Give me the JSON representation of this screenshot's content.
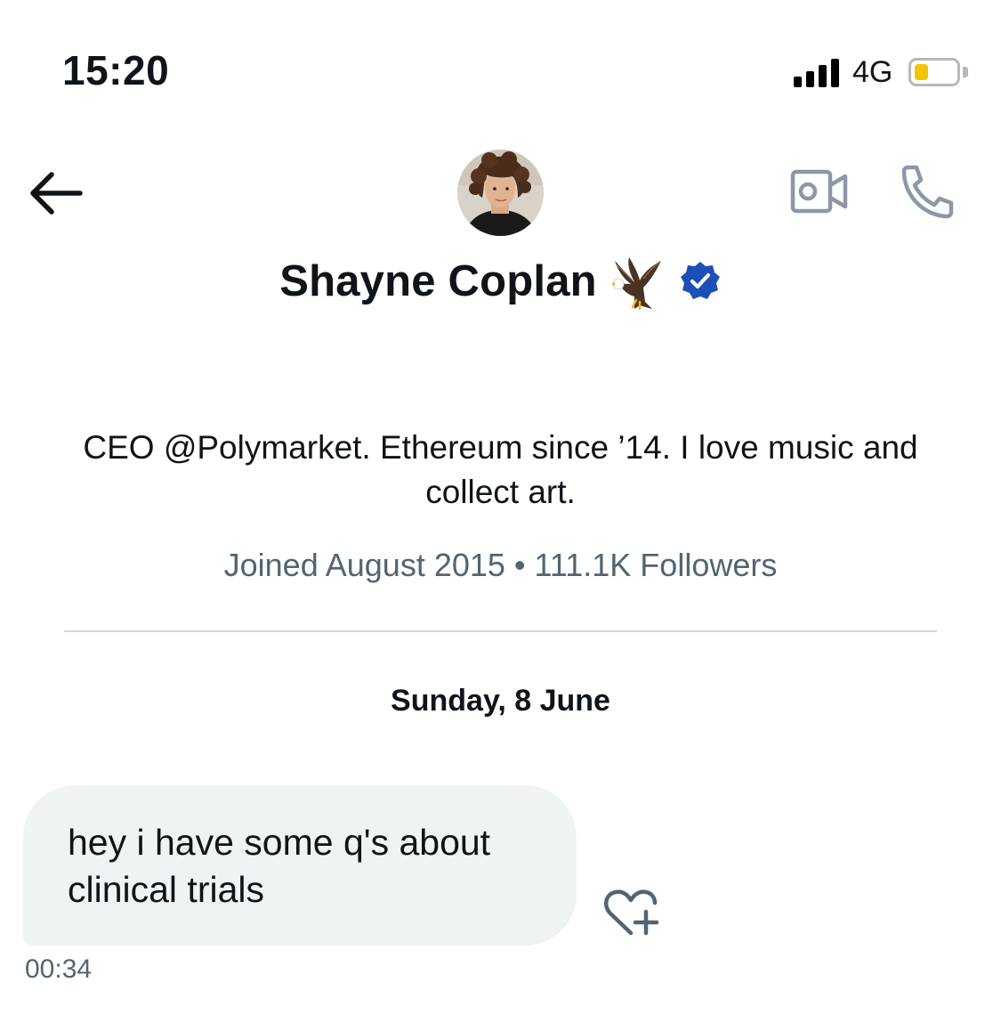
{
  "status_bar": {
    "time": "15:20",
    "network": "4G",
    "signal_bars": 4,
    "battery_level": 0.35,
    "battery_color": "#f5c400"
  },
  "header": {
    "back_icon": "arrow-left-icon",
    "video_icon": "video-camera-icon",
    "call_icon": "phone-icon"
  },
  "profile": {
    "name": "Shayne Coplan",
    "emoji": "eagle",
    "verified": true,
    "verified_color": "#1d4fb8",
    "bio": "CEO @Polymarket. Ethereum since ’14. I love music and collect art.",
    "joined": "Joined August 2015",
    "separator": "•",
    "followers": "111.1K Followers"
  },
  "conversation": {
    "date_separator": "Sunday, 8 June",
    "messages": [
      {
        "text": "hey i have some q's about clinical trials",
        "time": "00:34",
        "reaction_icon": "heart-plus-icon"
      }
    ]
  }
}
